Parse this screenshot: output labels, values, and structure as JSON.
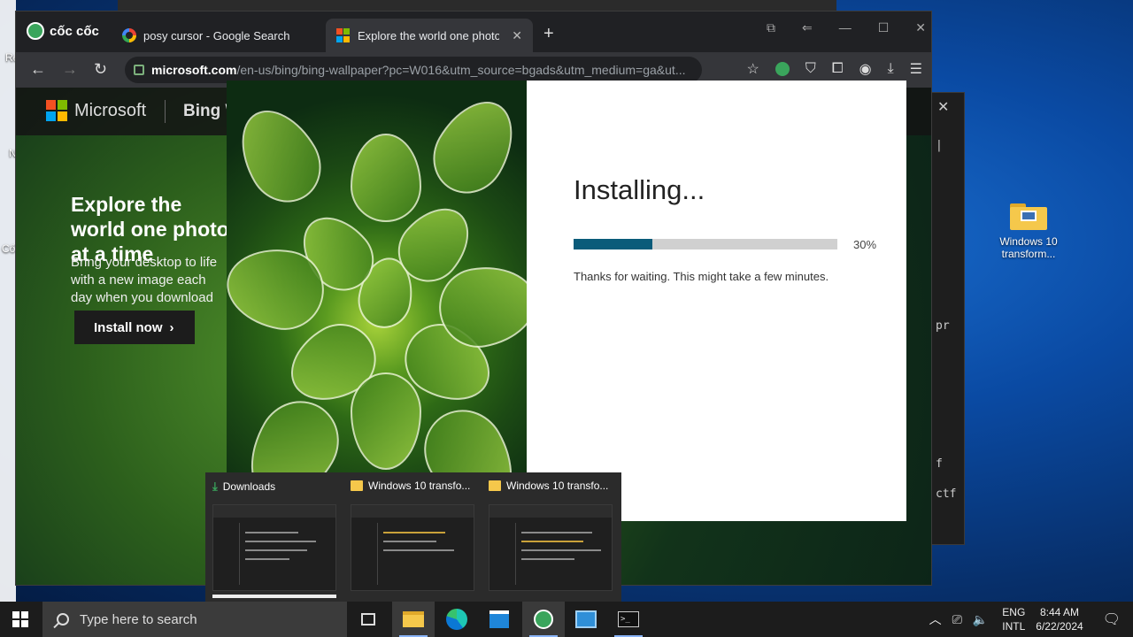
{
  "desktop": {
    "icons": [
      {
        "label": "Windows 10 transform..."
      }
    ],
    "left_fragments": [
      "Re",
      "N",
      "Cố"
    ]
  },
  "terminal": {
    "close": "✕",
    "lines": [
      "|",
      "pr",
      "f",
      "ctf"
    ]
  },
  "browser": {
    "brand": "cốc cốc",
    "tabs": [
      {
        "title": "posy cursor - Google Search",
        "active": false
      },
      {
        "title": "Explore the world one photo",
        "active": true
      }
    ],
    "new_tab": "+",
    "url_host": "microsoft.com",
    "url_rest": "/en-us/bing/bing-wallpaper?pc=W016&utm_source=bgads&utm_medium=ga&ut..."
  },
  "page": {
    "ms_logo_text": "Microsoft",
    "bing_title": "Bing W",
    "hero_title": "Explore the world one photo at a time",
    "hero_sub": "Bring your desktop to life with a new image each day when you download",
    "install_label": "Install now",
    "install_chevron": "›"
  },
  "installer": {
    "title": "Installing...",
    "progress": 0.3,
    "percent_label": "30%",
    "message": "Thanks for waiting. This might take a few minutes."
  },
  "previews": [
    {
      "title": "Downloads",
      "icon": "download-icon"
    },
    {
      "title": "Windows 10 transfo...",
      "icon": "folder-icon"
    },
    {
      "title": "Windows 10 transfo...",
      "icon": "folder-icon"
    }
  ],
  "taskbar": {
    "search_placeholder": "Type here to search",
    "lang_top": "ENG",
    "lang_bottom": "INTL",
    "time": "8:44 AM",
    "date": "6/22/2024"
  },
  "colors": {
    "progress_fill": "#0a5b7a",
    "progress_track": "#d0d0d0",
    "accent": "#3aa55c"
  }
}
